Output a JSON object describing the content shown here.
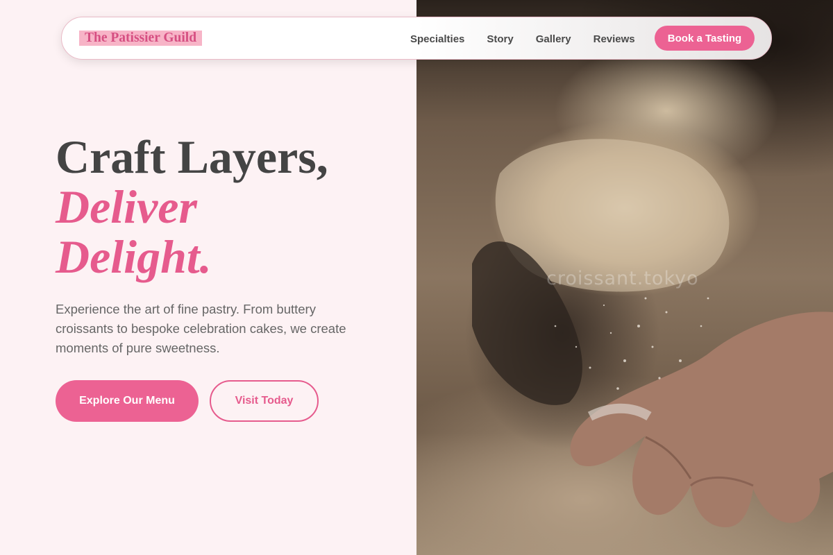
{
  "header": {
    "brand": "The Patissier Guild",
    "nav": [
      "Specialties",
      "Story",
      "Gallery",
      "Reviews"
    ],
    "cta": "Book a Tasting"
  },
  "hero": {
    "headline_line1": "Craft Layers,",
    "headline_line2": "Deliver",
    "headline_line3": "Delight.",
    "description": "Experience the art of fine pastry. From buttery croissants to bespoke celebration cakes, we create moments of pure sweetness.",
    "primary_button": "Explore Our Menu",
    "secondary_button": "Visit Today"
  },
  "image": {
    "watermark": "croissant.tokyo"
  },
  "colors": {
    "accent": "#ec6293",
    "background": "#fdf2f4",
    "heading": "#444444",
    "body_text": "#666666"
  }
}
